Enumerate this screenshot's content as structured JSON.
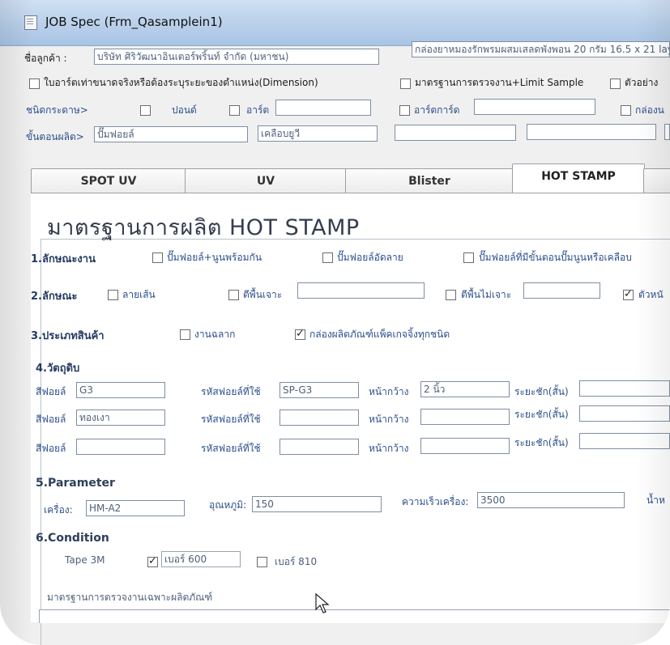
{
  "window": {
    "title": "JOB Spec (Frm_Qasamplein1)"
  },
  "top": {
    "customer_label": "ชื่อลูกค้า :",
    "customer_value": "บริษัท ศิริวัฒนาอินเตอร์พริ้นท์ จำกัด (มหาชน)",
    "product_value": "กล่องยาหมองรักพรมผสมเสลดพังพอน 20 กรัม 16.5 x 21 lay",
    "dimension_check_label": "ใบอาร์ตเท่าขนาดจริงหรือต้องระบุระยะของตำแหน่ง(Dimension)",
    "qc_standard_label": "มาตรฐานการตรวจงาน+Limit Sample",
    "sample_label": "ตัวอย่าง",
    "paper_type_label": "ชนิดกระดาษ>",
    "paper_pond_label": "ปอนด์",
    "paper_art_label": "อาร์ต",
    "paper_artcard_label": "อาร์ตการ์ด",
    "paper_box_label": "กล่องน",
    "process_label": "ขั้นตอนผลิต>",
    "process_1": "ปั๊มฟอยล์",
    "process_2": "เคลือบยูวี"
  },
  "tabs": [
    {
      "label": "SPOT UV",
      "active": false
    },
    {
      "label": "UV",
      "active": false
    },
    {
      "label": "Blister",
      "active": false
    },
    {
      "label": "HOT STAMP",
      "active": true
    }
  ],
  "panel": {
    "title": "มาตรฐานการผลิต HOT STAMP",
    "q1": {
      "label": "1.ลักษณะงาน",
      "opt1": "ปั๊มฟอยล์+นูนพร้อมกัน",
      "opt2": "ปั๊มฟอยล์อัดลาย",
      "opt3": "ปั๊มฟอยล์ที่มีขั้นตอนปั๊มนูนหรือเคลือบ"
    },
    "q2": {
      "label": "2.ลักษณะ",
      "opt1": "ลายเส้น",
      "opt2": "ตีพื้นเจาะ",
      "opt3": "ตีพื้นไม่เจาะ",
      "opt4": "ตัวหนั"
    },
    "q3": {
      "label": "3.ประเภทสินค้า",
      "opt1": "งานฉลาก",
      "opt2": "กล่องผลิตภัณฑ์แพ็คเกจจิ้งทุกชนิด"
    },
    "q4": {
      "label": "4.วัตถุดิบ",
      "rows": [
        {
          "foil_label": "สีฟอยล์",
          "foil": "G3",
          "code_label": "รหัสฟอยล์ที่ใช้",
          "code": "SP-G3",
          "width_label": "หน้ากว้าง",
          "width": "2 นิ้ว",
          "interval_label": "ระยะชัก(สั้น)"
        },
        {
          "foil_label": "สีฟอยล์",
          "foil": "ทองเงา",
          "code_label": "รหัสฟอยล์ที่ใช้",
          "code": "",
          "width_label": "หน้ากว้าง",
          "width": "",
          "interval_label": "ระยะชัก(สั้น)"
        },
        {
          "foil_label": "สีฟอยล์",
          "foil": "",
          "code_label": "รหัสฟอยล์ที่ใช้",
          "code": "",
          "width_label": "หน้ากว้าง",
          "width": "",
          "interval_label": "ระยะชัก(สั้น)"
        }
      ]
    },
    "q5": {
      "label": "5.Parameter",
      "machine_label": "เครื่อง:",
      "machine": "HM-A2",
      "temp_label": "อุณหภูมิ:",
      "temp": "150",
      "speed_label": "ความเร็วเครื่อง:",
      "speed": "3500",
      "weight_label": "น้ำห"
    },
    "q6": {
      "label": "6.Condition",
      "tape_label": "Tape 3M",
      "opt1": "เบอร์ 600",
      "opt2": "เบอร์ 810"
    },
    "standard_label": "มาตรฐานการตรวจงานเฉพาะผลิตภัณฑ์"
  }
}
